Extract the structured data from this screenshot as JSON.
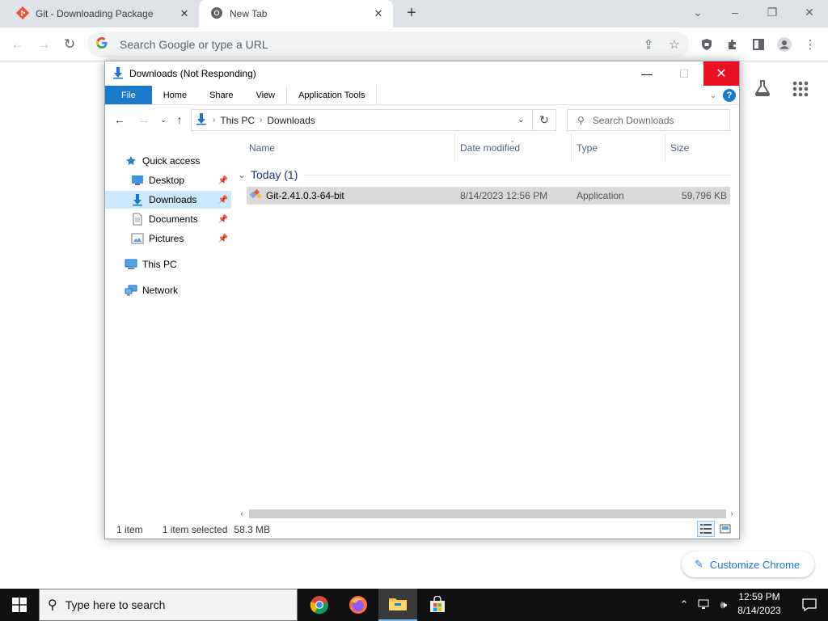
{
  "chrome": {
    "tabs": [
      {
        "title": "Git - Downloading Package",
        "icon": "git-icon"
      },
      {
        "title": "New Tab",
        "icon": "chrome-icon"
      }
    ],
    "omnibox_placeholder": "Search Google or type a URL",
    "customize_label": "Customize Chrome"
  },
  "explorer": {
    "title": "Downloads (Not Responding)",
    "ribbon_tabs": [
      "File",
      "Home",
      "Share",
      "View",
      "Application Tools"
    ],
    "path": [
      "This PC",
      "Downloads"
    ],
    "search_placeholder": "Search Downloads",
    "nav": {
      "quick_access": "Quick access",
      "items": [
        "Desktop",
        "Downloads",
        "Documents",
        "Pictures"
      ],
      "this_pc": "This PC",
      "network": "Network"
    },
    "columns": [
      "Name",
      "Date modified",
      "Type",
      "Size"
    ],
    "group": "Today (1)",
    "file": {
      "name": "Git-2.41.0.3-64-bit",
      "date": "8/14/2023 12:56 PM",
      "type": "Application",
      "size": "59,796 KB"
    },
    "status": {
      "count": "1 item",
      "selected": "1 item selected",
      "size": "58.3 MB"
    }
  },
  "taskbar": {
    "search_placeholder": "Type here to search",
    "time": "12:59 PM",
    "date": "8/14/2023"
  },
  "colors": {
    "file_tab": "#1979ca",
    "close_red": "#e81123",
    "selection": "#cce8ff",
    "chrome_blue": "#1a73e8"
  }
}
